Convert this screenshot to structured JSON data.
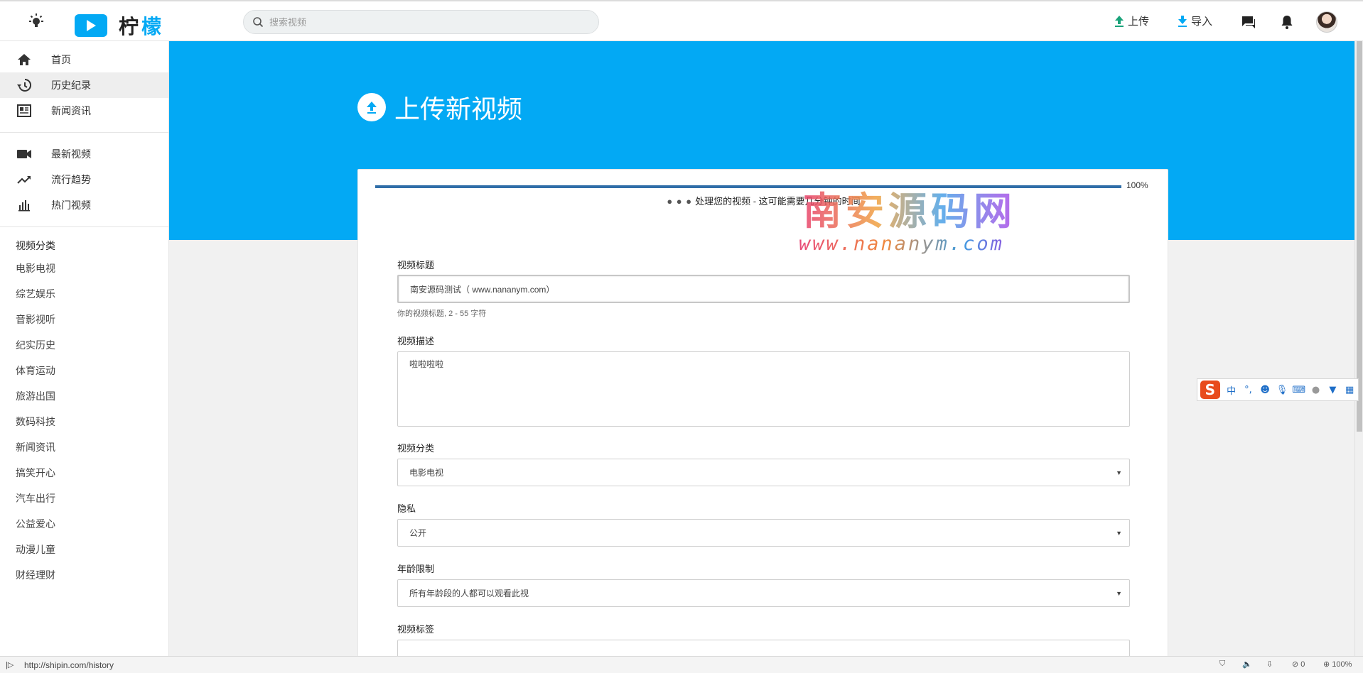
{
  "topbar": {
    "logo_text_1": "柠",
    "logo_text_2": "檬",
    "search_placeholder": "搜索视频",
    "upload_label": "上传",
    "import_label": "导入"
  },
  "sidebar": {
    "main_items": [
      {
        "label": "首页",
        "icon": "home-icon"
      },
      {
        "label": "历史纪录",
        "icon": "history-icon"
      },
      {
        "label": "新闻资讯",
        "icon": "news-icon"
      }
    ],
    "video_items": [
      {
        "label": "最新视频",
        "icon": "video-camera-icon"
      },
      {
        "label": "流行趋势",
        "icon": "trending-icon"
      },
      {
        "label": "热门视频",
        "icon": "bar-chart-icon"
      }
    ],
    "category_title": "视频分类",
    "categories": [
      "电影电视",
      "综艺娱乐",
      "音影视听",
      "纪实历史",
      "体育运动",
      "旅游出国",
      "数码科技",
      "新闻资讯",
      "搞笑开心",
      "汽车出行",
      "公益爱心",
      "动漫儿童",
      "财经理财"
    ]
  },
  "hero": {
    "title": "上传新视频"
  },
  "upload": {
    "progress_percent": 100,
    "progress_label": "100%",
    "processing_text": "处理您的视频 - 这可能需要几分钟的时间",
    "processing_dots": "● ● ●"
  },
  "form": {
    "title_label": "视频标题",
    "title_value": "南安源码测试（ www.nananym.com）",
    "title_hint": "你的视频标题, 2 - 55 字符",
    "desc_label": "视频描述",
    "desc_value": "啦啦啦啦",
    "category_label": "视频分类",
    "category_value": "电影电视",
    "privacy_label": "隐私",
    "privacy_value": "公开",
    "age_label": "年龄限制",
    "age_value": "所有年龄段的人都可以观看此视",
    "tags_label": "视频标签"
  },
  "watermark": {
    "main": "南安源码网",
    "sub": "www.nananym.com"
  },
  "ime": {
    "logo": "S",
    "lang": "中",
    "punct": "°,"
  },
  "statusbar": {
    "url": "http://shipin.com/history",
    "zoom": "100%",
    "count": "0"
  },
  "colors": {
    "accent": "#03a9f4",
    "progress": "#2f6ea8",
    "upload_icon": "#1aa37a"
  }
}
